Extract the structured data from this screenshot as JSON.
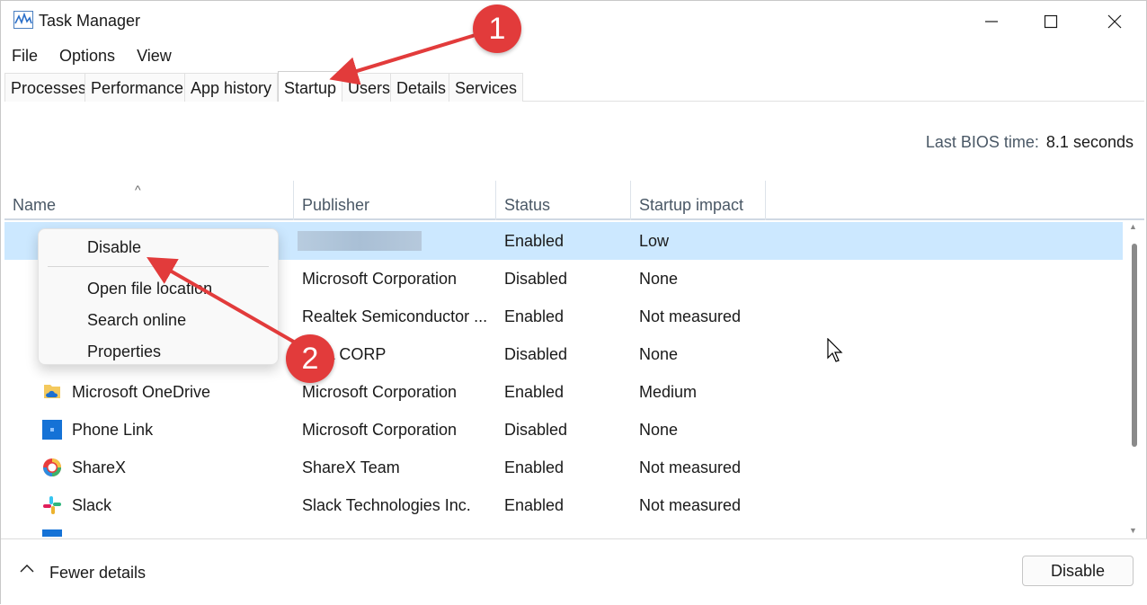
{
  "window": {
    "title": "Task Manager"
  },
  "menu": [
    "File",
    "Options",
    "View"
  ],
  "tabs": [
    "Processes",
    "Performance",
    "App history",
    "Startup",
    "Users",
    "Details",
    "Services"
  ],
  "active_tab": "Startup",
  "bios": {
    "label": "Last BIOS time:",
    "value": "8.1 seconds"
  },
  "columns": {
    "name": "Name",
    "publisher": "Publisher",
    "status": "Status",
    "impact": "Startup impact"
  },
  "rows": [
    {
      "name": "",
      "publisher": "",
      "status": "Enabled",
      "impact": "Low",
      "icon": "blurred"
    },
    {
      "name": "",
      "publisher": "Microsoft Corporation",
      "status": "Disabled",
      "impact": "None",
      "icon": "none"
    },
    {
      "name": "",
      "publisher": "Realtek Semiconductor ...",
      "status": "Enabled",
      "impact": "Not measured",
      "icon": "none"
    },
    {
      "name": "",
      "publisher": "EL CORP",
      "status": "Disabled",
      "impact": "None",
      "icon": "none"
    },
    {
      "name": "Microsoft OneDrive",
      "publisher": "Microsoft Corporation",
      "status": "Enabled",
      "impact": "Medium",
      "icon": "onedrive-icon"
    },
    {
      "name": "Phone Link",
      "publisher": "Microsoft Corporation",
      "status": "Disabled",
      "impact": "None",
      "icon": "phone-link-icon"
    },
    {
      "name": "ShareX",
      "publisher": "ShareX Team",
      "status": "Enabled",
      "impact": "Not measured",
      "icon": "sharex-icon"
    },
    {
      "name": "Slack",
      "publisher": "Slack Technologies Inc.",
      "status": "Enabled",
      "impact": "Not measured",
      "icon": "slack-icon"
    }
  ],
  "context_menu": [
    "Disable",
    "Open file location",
    "Search online",
    "Properties"
  ],
  "footer": {
    "fewer_details": "Fewer details",
    "disable_button": "Disable"
  },
  "annotations": {
    "badge1": "1",
    "badge2": "2"
  },
  "colors": {
    "selected_row": "#cce8ff",
    "annotation_red": "#e23b3b"
  }
}
